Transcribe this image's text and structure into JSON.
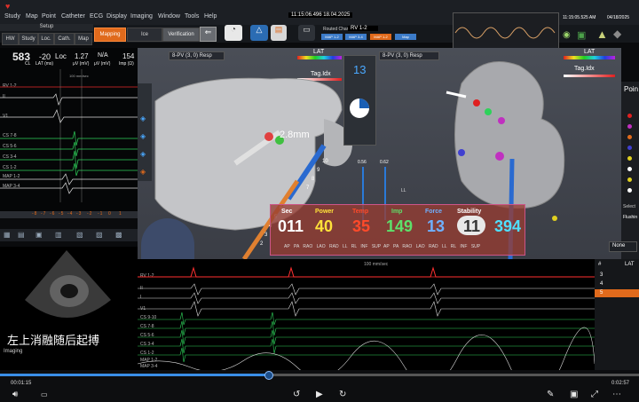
{
  "menu": {
    "items": [
      "Study",
      "Map",
      "Point",
      "Catheter",
      "ECG",
      "Display",
      "Imaging",
      "Window",
      "Tools",
      "Help"
    ]
  },
  "toolbar": {
    "setup_label": "Setup",
    "tabs": [
      "HW",
      "Study",
      "Loc.",
      "Cath.",
      "Map"
    ],
    "mapping_label": "Mapping",
    "ice_label": "Ice",
    "verification_label": "Verification",
    "timestamp_center": "11:15:06.496 18.04.2025",
    "routed_channel_label": "Routed Channel:",
    "routed_channel_value": "RV 1-2",
    "routed_buttons": [
      "MAP 1-2",
      "MAP 3-4",
      "MAP 1-2",
      "Map"
    ],
    "timestamp_right_time": "11:15:05.525 AM",
    "timestamp_right_date": "04/18/2025"
  },
  "left_panel": {
    "cl_value": "583",
    "cl_label": "CL",
    "lat_value": "-20",
    "lat_label": "LAT (ms)",
    "loc_label": "Loc",
    "imp_value": "1.27",
    "imp_label": "μV (mV)",
    "na_value": "N/A",
    "na_label": "μV (mV)",
    "imp2_value": "154",
    "imp2_label": "Imp (Ω)",
    "speed": "100 mm/sec",
    "traces": [
      "RV 1-2",
      "II",
      "V1",
      "CS 7-8",
      "CS 5-6",
      "CS 3-4",
      "CS 1-2",
      "MAP 1-2",
      "MAP 3-4"
    ],
    "ruler": [
      "-1",
      "-1",
      "-50",
      "0",
      "50"
    ],
    "scale_nums": [
      "-8",
      "-7",
      "-6",
      "-5",
      "-4",
      "-3",
      "-2",
      "-1",
      "0",
      "1"
    ]
  },
  "map_left": {
    "title": "8-PV (3, 0) Resp",
    "lat_label": "LAT",
    "tag_label": "Tag.Idx",
    "distance": "2.8mm",
    "rotation_value": "13",
    "side_numbers": [
      "17"
    ],
    "catheter_numbers": [
      "2",
      "3",
      "4",
      "5",
      "6",
      "7",
      "8",
      "9",
      "10"
    ],
    "slider_values": [
      "0.56",
      "0.62"
    ]
  },
  "map_right": {
    "title": "8-PV (3, 0) Resp",
    "lat_label": "LAT",
    "tag_label": "Tag.Idx",
    "ll_label": "LL",
    "points_header": "Poin",
    "select_label": "Select",
    "select_value": "Flushin",
    "dropdown_value": "None"
  },
  "ablation": {
    "labels": [
      "Sec",
      "Power",
      "Temp",
      "Imp",
      "Force",
      "Stability"
    ],
    "values": [
      "011",
      "40",
      "35",
      "149",
      "13",
      "11",
      "394"
    ],
    "label_colors": [
      "#ffffff",
      "#ffe23a",
      "#ff4a2a",
      "#5ee06a",
      "#6fb0ff",
      "#ffffff",
      "#4fe0ff"
    ],
    "leads_left": [
      "AP",
      "PA",
      "RAO",
      "LAO",
      "RAD",
      "LL",
      "RL",
      "INF",
      "SUP"
    ],
    "leads_right": [
      "AP",
      "PA",
      "RAO",
      "LAO",
      "RAD",
      "LL",
      "RL",
      "INF",
      "SUP"
    ]
  },
  "lower_ecg": {
    "speed": "100 mm/sec",
    "traces": [
      "RV 1-2",
      "II",
      "I",
      "V1",
      "CS 9-10",
      "CS 7-8",
      "CS 5-6",
      "CS 3-4",
      "CS 1-2",
      "MAP 1-2",
      "MAP 3-4"
    ],
    "list_header_num": "#",
    "list_header_lat": "LAT",
    "list_rows": [
      "3",
      "4",
      "5"
    ]
  },
  "echo": {
    "imaging_label": "Imaging",
    "caption": "左上消融随后起搏"
  },
  "player": {
    "current_time": "00:01:15",
    "duration": "0:02:57",
    "progress": 0.42
  },
  "colors": {
    "accent_orange": "#e06a1c",
    "ecg_green": "#2ed25a",
    "ecg_red": "#ff3030",
    "progress_blue": "#3a8fe8"
  }
}
